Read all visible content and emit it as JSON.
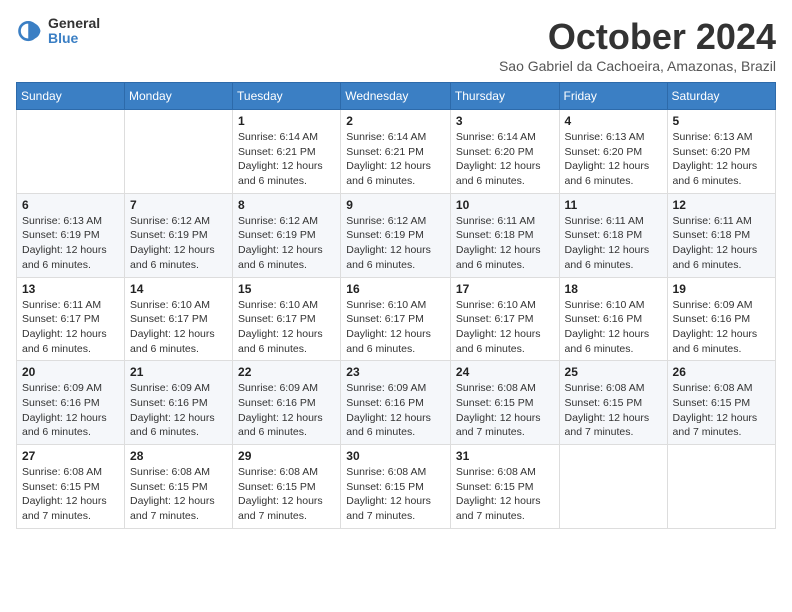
{
  "logo": {
    "general": "General",
    "blue": "Blue"
  },
  "title": {
    "month": "October 2024",
    "location": "Sao Gabriel da Cachoeira, Amazonas, Brazil"
  },
  "weekdays": [
    "Sunday",
    "Monday",
    "Tuesday",
    "Wednesday",
    "Thursday",
    "Friday",
    "Saturday"
  ],
  "weeks": [
    [
      {
        "day": "",
        "sunrise": "",
        "sunset": "",
        "daylight": ""
      },
      {
        "day": "",
        "sunrise": "",
        "sunset": "",
        "daylight": ""
      },
      {
        "day": "1",
        "sunrise": "Sunrise: 6:14 AM",
        "sunset": "Sunset: 6:21 PM",
        "daylight": "Daylight: 12 hours and 6 minutes."
      },
      {
        "day": "2",
        "sunrise": "Sunrise: 6:14 AM",
        "sunset": "Sunset: 6:21 PM",
        "daylight": "Daylight: 12 hours and 6 minutes."
      },
      {
        "day": "3",
        "sunrise": "Sunrise: 6:14 AM",
        "sunset": "Sunset: 6:20 PM",
        "daylight": "Daylight: 12 hours and 6 minutes."
      },
      {
        "day": "4",
        "sunrise": "Sunrise: 6:13 AM",
        "sunset": "Sunset: 6:20 PM",
        "daylight": "Daylight: 12 hours and 6 minutes."
      },
      {
        "day": "5",
        "sunrise": "Sunrise: 6:13 AM",
        "sunset": "Sunset: 6:20 PM",
        "daylight": "Daylight: 12 hours and 6 minutes."
      }
    ],
    [
      {
        "day": "6",
        "sunrise": "Sunrise: 6:13 AM",
        "sunset": "Sunset: 6:19 PM",
        "daylight": "Daylight: 12 hours and 6 minutes."
      },
      {
        "day": "7",
        "sunrise": "Sunrise: 6:12 AM",
        "sunset": "Sunset: 6:19 PM",
        "daylight": "Daylight: 12 hours and 6 minutes."
      },
      {
        "day": "8",
        "sunrise": "Sunrise: 6:12 AM",
        "sunset": "Sunset: 6:19 PM",
        "daylight": "Daylight: 12 hours and 6 minutes."
      },
      {
        "day": "9",
        "sunrise": "Sunrise: 6:12 AM",
        "sunset": "Sunset: 6:19 PM",
        "daylight": "Daylight: 12 hours and 6 minutes."
      },
      {
        "day": "10",
        "sunrise": "Sunrise: 6:11 AM",
        "sunset": "Sunset: 6:18 PM",
        "daylight": "Daylight: 12 hours and 6 minutes."
      },
      {
        "day": "11",
        "sunrise": "Sunrise: 6:11 AM",
        "sunset": "Sunset: 6:18 PM",
        "daylight": "Daylight: 12 hours and 6 minutes."
      },
      {
        "day": "12",
        "sunrise": "Sunrise: 6:11 AM",
        "sunset": "Sunset: 6:18 PM",
        "daylight": "Daylight: 12 hours and 6 minutes."
      }
    ],
    [
      {
        "day": "13",
        "sunrise": "Sunrise: 6:11 AM",
        "sunset": "Sunset: 6:17 PM",
        "daylight": "Daylight: 12 hours and 6 minutes."
      },
      {
        "day": "14",
        "sunrise": "Sunrise: 6:10 AM",
        "sunset": "Sunset: 6:17 PM",
        "daylight": "Daylight: 12 hours and 6 minutes."
      },
      {
        "day": "15",
        "sunrise": "Sunrise: 6:10 AM",
        "sunset": "Sunset: 6:17 PM",
        "daylight": "Daylight: 12 hours and 6 minutes."
      },
      {
        "day": "16",
        "sunrise": "Sunrise: 6:10 AM",
        "sunset": "Sunset: 6:17 PM",
        "daylight": "Daylight: 12 hours and 6 minutes."
      },
      {
        "day": "17",
        "sunrise": "Sunrise: 6:10 AM",
        "sunset": "Sunset: 6:17 PM",
        "daylight": "Daylight: 12 hours and 6 minutes."
      },
      {
        "day": "18",
        "sunrise": "Sunrise: 6:10 AM",
        "sunset": "Sunset: 6:16 PM",
        "daylight": "Daylight: 12 hours and 6 minutes."
      },
      {
        "day": "19",
        "sunrise": "Sunrise: 6:09 AM",
        "sunset": "Sunset: 6:16 PM",
        "daylight": "Daylight: 12 hours and 6 minutes."
      }
    ],
    [
      {
        "day": "20",
        "sunrise": "Sunrise: 6:09 AM",
        "sunset": "Sunset: 6:16 PM",
        "daylight": "Daylight: 12 hours and 6 minutes."
      },
      {
        "day": "21",
        "sunrise": "Sunrise: 6:09 AM",
        "sunset": "Sunset: 6:16 PM",
        "daylight": "Daylight: 12 hours and 6 minutes."
      },
      {
        "day": "22",
        "sunrise": "Sunrise: 6:09 AM",
        "sunset": "Sunset: 6:16 PM",
        "daylight": "Daylight: 12 hours and 6 minutes."
      },
      {
        "day": "23",
        "sunrise": "Sunrise: 6:09 AM",
        "sunset": "Sunset: 6:16 PM",
        "daylight": "Daylight: 12 hours and 6 minutes."
      },
      {
        "day": "24",
        "sunrise": "Sunrise: 6:08 AM",
        "sunset": "Sunset: 6:15 PM",
        "daylight": "Daylight: 12 hours and 7 minutes."
      },
      {
        "day": "25",
        "sunrise": "Sunrise: 6:08 AM",
        "sunset": "Sunset: 6:15 PM",
        "daylight": "Daylight: 12 hours and 7 minutes."
      },
      {
        "day": "26",
        "sunrise": "Sunrise: 6:08 AM",
        "sunset": "Sunset: 6:15 PM",
        "daylight": "Daylight: 12 hours and 7 minutes."
      }
    ],
    [
      {
        "day": "27",
        "sunrise": "Sunrise: 6:08 AM",
        "sunset": "Sunset: 6:15 PM",
        "daylight": "Daylight: 12 hours and 7 minutes."
      },
      {
        "day": "28",
        "sunrise": "Sunrise: 6:08 AM",
        "sunset": "Sunset: 6:15 PM",
        "daylight": "Daylight: 12 hours and 7 minutes."
      },
      {
        "day": "29",
        "sunrise": "Sunrise: 6:08 AM",
        "sunset": "Sunset: 6:15 PM",
        "daylight": "Daylight: 12 hours and 7 minutes."
      },
      {
        "day": "30",
        "sunrise": "Sunrise: 6:08 AM",
        "sunset": "Sunset: 6:15 PM",
        "daylight": "Daylight: 12 hours and 7 minutes."
      },
      {
        "day": "31",
        "sunrise": "Sunrise: 6:08 AM",
        "sunset": "Sunset: 6:15 PM",
        "daylight": "Daylight: 12 hours and 7 minutes."
      },
      {
        "day": "",
        "sunrise": "",
        "sunset": "",
        "daylight": ""
      },
      {
        "day": "",
        "sunrise": "",
        "sunset": "",
        "daylight": ""
      }
    ]
  ]
}
